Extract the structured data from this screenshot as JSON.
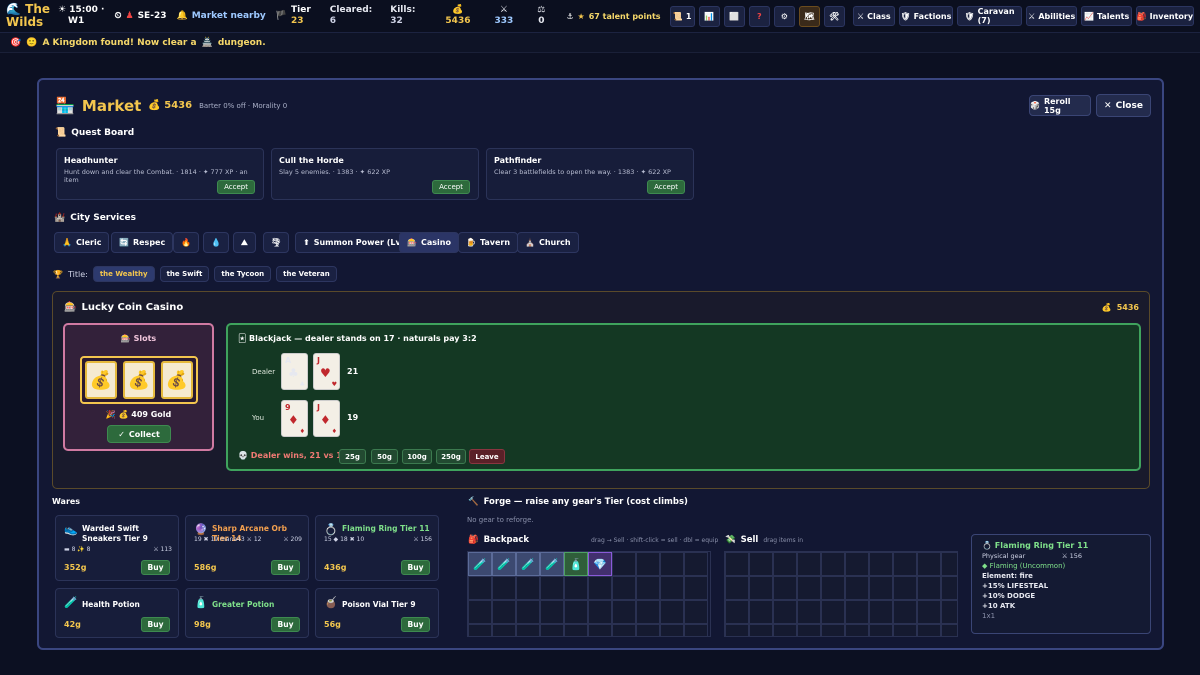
{
  "topbar": {
    "logo": "The Wilds",
    "time": "15:00 ·",
    "week": "W1",
    "season": "SE-23",
    "market": "Market nearby",
    "tier_label": "Tier",
    "tier_value": "23",
    "cleared_label": "Cleared:",
    "cleared_value": "6",
    "kills_label": "Kills:",
    "kills_value": "32",
    "gold": "5436",
    "attack": "333",
    "balance": "0",
    "talent_points": "67 talent points",
    "scroll_count": "1",
    "buttons": [
      {
        "label": "Class"
      },
      {
        "label": "Factions"
      },
      {
        "label": "Caravan (7)"
      },
      {
        "label": "Abilities"
      },
      {
        "label": "Talents"
      },
      {
        "label": "Inventory"
      }
    ]
  },
  "notice": "A Kingdom found! Now clear a",
  "notice_end": "dungeon.",
  "market": {
    "title": "Market",
    "gold": "5436",
    "subtitle": "Barter 0% off · Morality 0",
    "reroll": "Reroll 15g",
    "close": "Close"
  },
  "quest_board": {
    "title": "Quest Board",
    "quests": [
      {
        "name": "Headhunter",
        "desc": "Hunt down and clear the Combat. · 1814 · ✦ 777 XP · an item",
        "action": "Accept"
      },
      {
        "name": "Cull the Horde",
        "desc": "Slay 5 enemies. · 1383 · ✦ 622 XP",
        "action": "Accept"
      },
      {
        "name": "Pathfinder",
        "desc": "Clear 3 battlefields to open the way. · 1383 · ✦ 622 XP",
        "action": "Accept"
      }
    ]
  },
  "services": {
    "title": "City Services",
    "items": [
      {
        "label": "Cleric",
        "icon": "🙏"
      },
      {
        "label": "Respec",
        "icon": "🔄"
      },
      {
        "label": "",
        "icon": "🔥"
      },
      {
        "label": "",
        "icon": "💧"
      },
      {
        "label": "",
        "icon": "⛰"
      },
      {
        "label": "",
        "icon": "🌪"
      },
      {
        "label": "Summon Power (Lv 0)",
        "icon": "⬆"
      },
      {
        "label": "Casino",
        "icon": "🎰"
      },
      {
        "label": "Tavern",
        "icon": "🍺"
      },
      {
        "label": "Church",
        "icon": "⛪"
      }
    ]
  },
  "titles": {
    "label": "Title:",
    "options": [
      "the Wealthy",
      "the Swift",
      "the Tycoon",
      "the Veteran"
    ],
    "active": "the Wealthy"
  },
  "casino": {
    "title": "Lucky Coin Casino",
    "gold": "5436",
    "slots": {
      "title": "Slots",
      "reels": [
        "💰",
        "💰",
        "💰"
      ],
      "result": "409 Gold",
      "collect": "Collect"
    },
    "blackjack": {
      "title": "Blackjack — dealer stands on 17 · naturals pay 3:2",
      "dealer_label": "Dealer",
      "dealer_total": "21",
      "dealer_cards": [
        {
          "rank": "A",
          "suit": "♣",
          "color": "#111"
        },
        {
          "rank": "J",
          "suit": "♥",
          "color": "#c0282d"
        }
      ],
      "you_label": "You",
      "you_total": "19",
      "you_cards": [
        {
          "rank": "9",
          "suit": "♦",
          "color": "#c0282d"
        },
        {
          "rank": "J",
          "suit": "♦",
          "color": "#c0282d"
        }
      ],
      "result": "Dealer wins, 21 vs 19.",
      "bets": [
        "25g",
        "50g",
        "100g",
        "250g"
      ],
      "leave": "Leave"
    }
  },
  "wares": {
    "title": "Wares",
    "items": [
      {
        "name": "Warded Swift Sneakers Tier 9",
        "icon": "👟",
        "stats_left": "▬ 8  ✨ 8",
        "stats_right": "⚔ 113",
        "price": "352g",
        "color": "#ffffff"
      },
      {
        "name": "Sharp Arcane Orb Tier 14",
        "icon": "🔮",
        "stats_left": "19 ✖ 19 mana43 ⚔ 12",
        "stats_right": "⚔ 209",
        "price": "586g",
        "color": "#f3a04e"
      },
      {
        "name": "Flaming Ring Tier 11",
        "icon": "💍",
        "stats_left": "15 ◆ 18 ✖ 10",
        "stats_right": "⚔ 156",
        "price": "436g",
        "color": "#7fe08a"
      },
      {
        "name": "Health Potion",
        "icon": "🧪",
        "stats_left": "",
        "stats_right": "",
        "price": "42g",
        "color": "#ffffff"
      },
      {
        "name": "Greater Potion",
        "icon": "🧴",
        "stats_left": "",
        "stats_right": "",
        "price": "98g",
        "color": "#7fe08a"
      },
      {
        "name": "Poison Vial Tier 9",
        "icon": "🧉",
        "stats_left": "",
        "stats_right": "",
        "price": "56g",
        "color": "#ffffff"
      }
    ],
    "buy": "Buy"
  },
  "forge": {
    "title": "Forge — raise any gear's Tier (cost climbs)",
    "empty": "No gear to reforge."
  },
  "backpack": {
    "title": "Backpack",
    "hint": "drag → Sell · shift-click = sell · dbl = equip",
    "items": [
      "🧪",
      "🧪",
      "🧪",
      "🧪",
      "🧴",
      "💎"
    ]
  },
  "sell": {
    "title": "Sell",
    "hint": "drag items in"
  },
  "tooltip": {
    "name": "Flaming Ring Tier 11",
    "type": "Physical gear",
    "power": "⚔ 156",
    "rarity": "◆ Flaming (Uncommon)",
    "lines": [
      "Element: fire",
      "+15% LIFESTEAL",
      "+10% DODGE",
      "+10 ATK"
    ],
    "size": "1x1"
  }
}
